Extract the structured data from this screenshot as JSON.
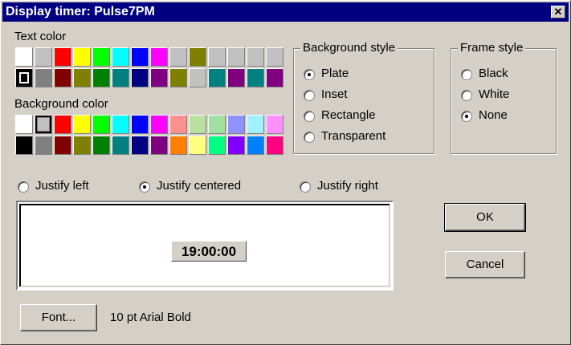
{
  "window": {
    "title": "Display timer: Pulse7PM"
  },
  "text_color": {
    "label": "Text color",
    "rows": [
      [
        "#ffffff",
        "#c0c0c0",
        "#ff0000",
        "#ffff00",
        "#00ff00",
        "#00ffff",
        "#0000ff",
        "#ff00ff",
        "#c0c0c0",
        "#808000",
        "#c0c0c0",
        "#c0c0c0",
        "#c0c0c0",
        "#c0c0c0"
      ],
      [
        "#000000",
        "#808080",
        "#800000",
        "#808000",
        "#008000",
        "#008080",
        "#000080",
        "#800080",
        "#808000",
        "#c0c0c0",
        "#008080",
        "#800080",
        "#008080",
        "#800080"
      ]
    ]
  },
  "background_color": {
    "label": "Background color",
    "rows": [
      [
        "#ffffff",
        "#c0c0c0",
        "#ff0000",
        "#ffff00",
        "#00ff00",
        "#00ffff",
        "#0000ff",
        "#ff00ff",
        "#ff9090",
        "#b8e0a0",
        "#a0e0a0",
        "#9090ff",
        "#a0f0ff",
        "#ff90ff"
      ],
      [
        "#000000",
        "#808080",
        "#800000",
        "#808000",
        "#008000",
        "#008080",
        "#000080",
        "#800080",
        "#ff8000",
        "#ffff80",
        "#00ff80",
        "#8000ff",
        "#0080ff",
        "#ff0080"
      ]
    ]
  },
  "background_style": {
    "label": "Background style",
    "options": [
      "Plate",
      "Inset",
      "Rectangle",
      "Transparent"
    ],
    "selected": "Plate"
  },
  "frame_style": {
    "label": "Frame style",
    "options": [
      "Black",
      "White",
      "None"
    ],
    "selected": "None"
  },
  "justify": {
    "options": [
      "Justify left",
      "Justify centered",
      "Justify right"
    ],
    "selected": "Justify centered"
  },
  "preview": {
    "time": "19:00:00"
  },
  "buttons": {
    "ok": "OK",
    "cancel": "Cancel",
    "font": "Font..."
  },
  "font_desc": "10 pt Arial Bold"
}
